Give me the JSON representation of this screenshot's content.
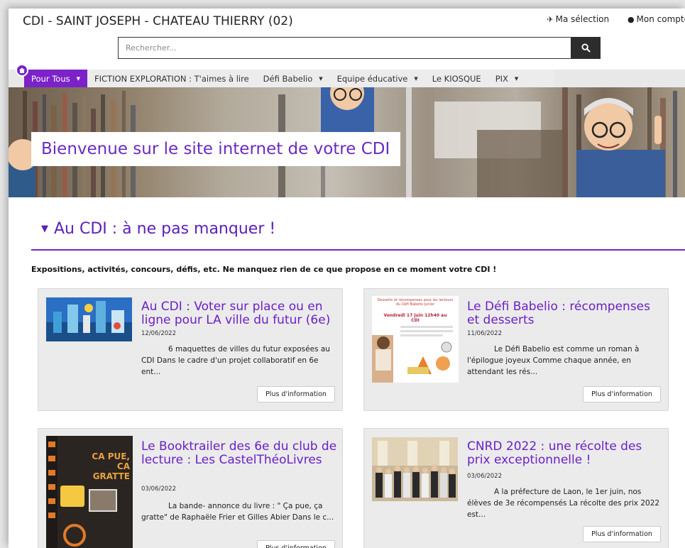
{
  "header": {
    "site_title": "CDI - SAINT JOSEPH - CHATEAU THIERRY (02)",
    "my_selection": "Ma sélection",
    "my_account": "Mon compte"
  },
  "search": {
    "placeholder": "Rechercher..."
  },
  "nav": {
    "items": [
      {
        "label": "Pour Tous",
        "has_dropdown": true,
        "active": true
      },
      {
        "label": "FICTION EXPLORATION : T'aimes à lire",
        "has_dropdown": false
      },
      {
        "label": "Défi Babelio",
        "has_dropdown": true
      },
      {
        "label": "Equipe éducative",
        "has_dropdown": true
      },
      {
        "label": "Le KIOSQUE",
        "has_dropdown": false
      },
      {
        "label": "PIX",
        "has_dropdown": true
      }
    ]
  },
  "banner": {
    "text": "Bienvenue sur le site internet de votre CDI"
  },
  "section": {
    "title": "Au CDI : à ne pas manquer !",
    "description": "Expositions, activités, concours, défis, etc. Ne manquez rien de ce que propose en ce moment votre CDI !"
  },
  "cards": [
    {
      "title": "Au CDI : Voter sur place ou en ligne pour LA ville du futur (6e)",
      "date": "12/06/2022",
      "text": "6 maquettes de villes du futur exposées au CDI Dans le cadre d'un projet collaboratif en 6e ent...",
      "button": "Plus d'information"
    },
    {
      "title": "Le Défi Babelio : récompenses et desserts",
      "date": "11/06/2022",
      "text": "Le Défi Babelio est comme un roman à l'épilogue joyeux Comme chaque année, en attendant les rés...",
      "button": "Plus d'information",
      "thumb_text": {
        "heading": "Desserts et récompenses pour les lecteurs du Défi Babelio Junior",
        "date": "Vendredi 17 juin 12h40 au CDI"
      }
    },
    {
      "title": "Le Booktrailer des 6e du club de lecture : Les CastelThéoLivres",
      "date": "03/06/2022",
      "text": "La bande- annonce du livre : \" Ça pue, ça gratte\" de Raphaële Frier et Gilles Abier Dans le c...",
      "button": "Plus d'information",
      "thumb_text": {
        "heading": "CA PUE, CA GRATTE"
      }
    },
    {
      "title": "CNRD 2022 : une récolte des prix exceptionnelle !",
      "date": "03/06/2022",
      "text": "A la préfecture de Laon, le 1er juin, nos élèves de 3e récompensés La récolte des prix 2022 est...",
      "button": "Plus d'information"
    }
  ],
  "colors": {
    "accent": "#7b22c8",
    "title_purple": "#6a21c6",
    "search_button": "#2d2d2d"
  }
}
